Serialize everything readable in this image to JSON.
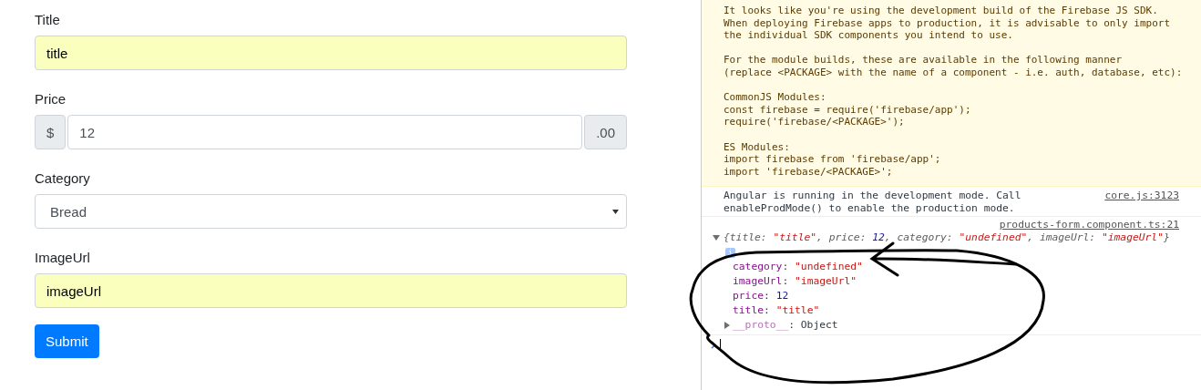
{
  "form": {
    "fields": [
      {
        "kind": "text",
        "label": "Title",
        "value": "title",
        "autofilled": true
      },
      {
        "kind": "addon",
        "label": "Price",
        "prefix": "$",
        "value": "12",
        "suffix": ".00",
        "autofilled": false
      },
      {
        "kind": "select",
        "label": "Category",
        "value": "Bread",
        "autofilled": false
      },
      {
        "kind": "text",
        "label": "ImageUrl",
        "value": "imageUrl",
        "autofilled": true
      }
    ],
    "submit": "Submit"
  },
  "console": {
    "messages": [
      {
        "kind": "warning",
        "paragraphs": [
          "It looks like you're using the development build of the Firebase JS SDK.\nWhen deploying Firebase apps to production, it is advisable to only import\nthe individual SDK components you intend to use.",
          "For the module builds, these are available in the following manner\n(replace <PACKAGE> with the name of a component - i.e. auth, database, etc):",
          "CommonJS Modules:\nconst firebase = require('firebase/app');\nrequire('firebase/<PACKAGE>');",
          "ES Modules:\nimport firebase from 'firebase/app';\nimport 'firebase/<PACKAGE>';"
        ]
      },
      {
        "kind": "log",
        "text": "Angular is running in the development mode. Call\nenableProdMode() to enable the production mode.",
        "source": "core.js:3123"
      },
      {
        "kind": "object",
        "source": "products-form.component.ts:21",
        "expanded": true,
        "summary": [
          {
            "t": "{title: ",
            "kind": "key"
          },
          {
            "t": "\"title\"",
            "kind": "string"
          },
          {
            "t": ", price: ",
            "kind": "key"
          },
          {
            "t": "12",
            "kind": "number"
          },
          {
            "t": ", category: ",
            "kind": "key"
          },
          {
            "t": "\"undefined\"",
            "kind": "string"
          },
          {
            "t": ", imageUrl: ",
            "kind": "key"
          },
          {
            "t": "\"imageUrl\"",
            "kind": "string"
          },
          {
            "t": "}",
            "kind": "key"
          }
        ],
        "info": "i",
        "properties": [
          [
            {
              "t": "category",
              "kind": "prop"
            },
            {
              "t": ": ",
              "kind": "plain"
            },
            {
              "t": "\"undefined\"",
              "kind": "string"
            }
          ],
          [
            {
              "t": "imageUrl",
              "kind": "prop"
            },
            {
              "t": ": ",
              "kind": "plain"
            },
            {
              "t": "\"imageUrl\"",
              "kind": "string"
            }
          ],
          [
            {
              "t": "price",
              "kind": "prop"
            },
            {
              "t": ": ",
              "kind": "plain"
            },
            {
              "t": "12",
              "kind": "number"
            }
          ],
          [
            {
              "t": "title",
              "kind": "prop"
            },
            {
              "t": ": ",
              "kind": "plain"
            },
            {
              "t": "\"title\"",
              "kind": "string"
            }
          ]
        ],
        "proto": [
          {
            "t": "__proto__",
            "kind": "proto"
          },
          {
            "t": ": Object",
            "kind": "plain"
          }
        ]
      }
    ]
  }
}
